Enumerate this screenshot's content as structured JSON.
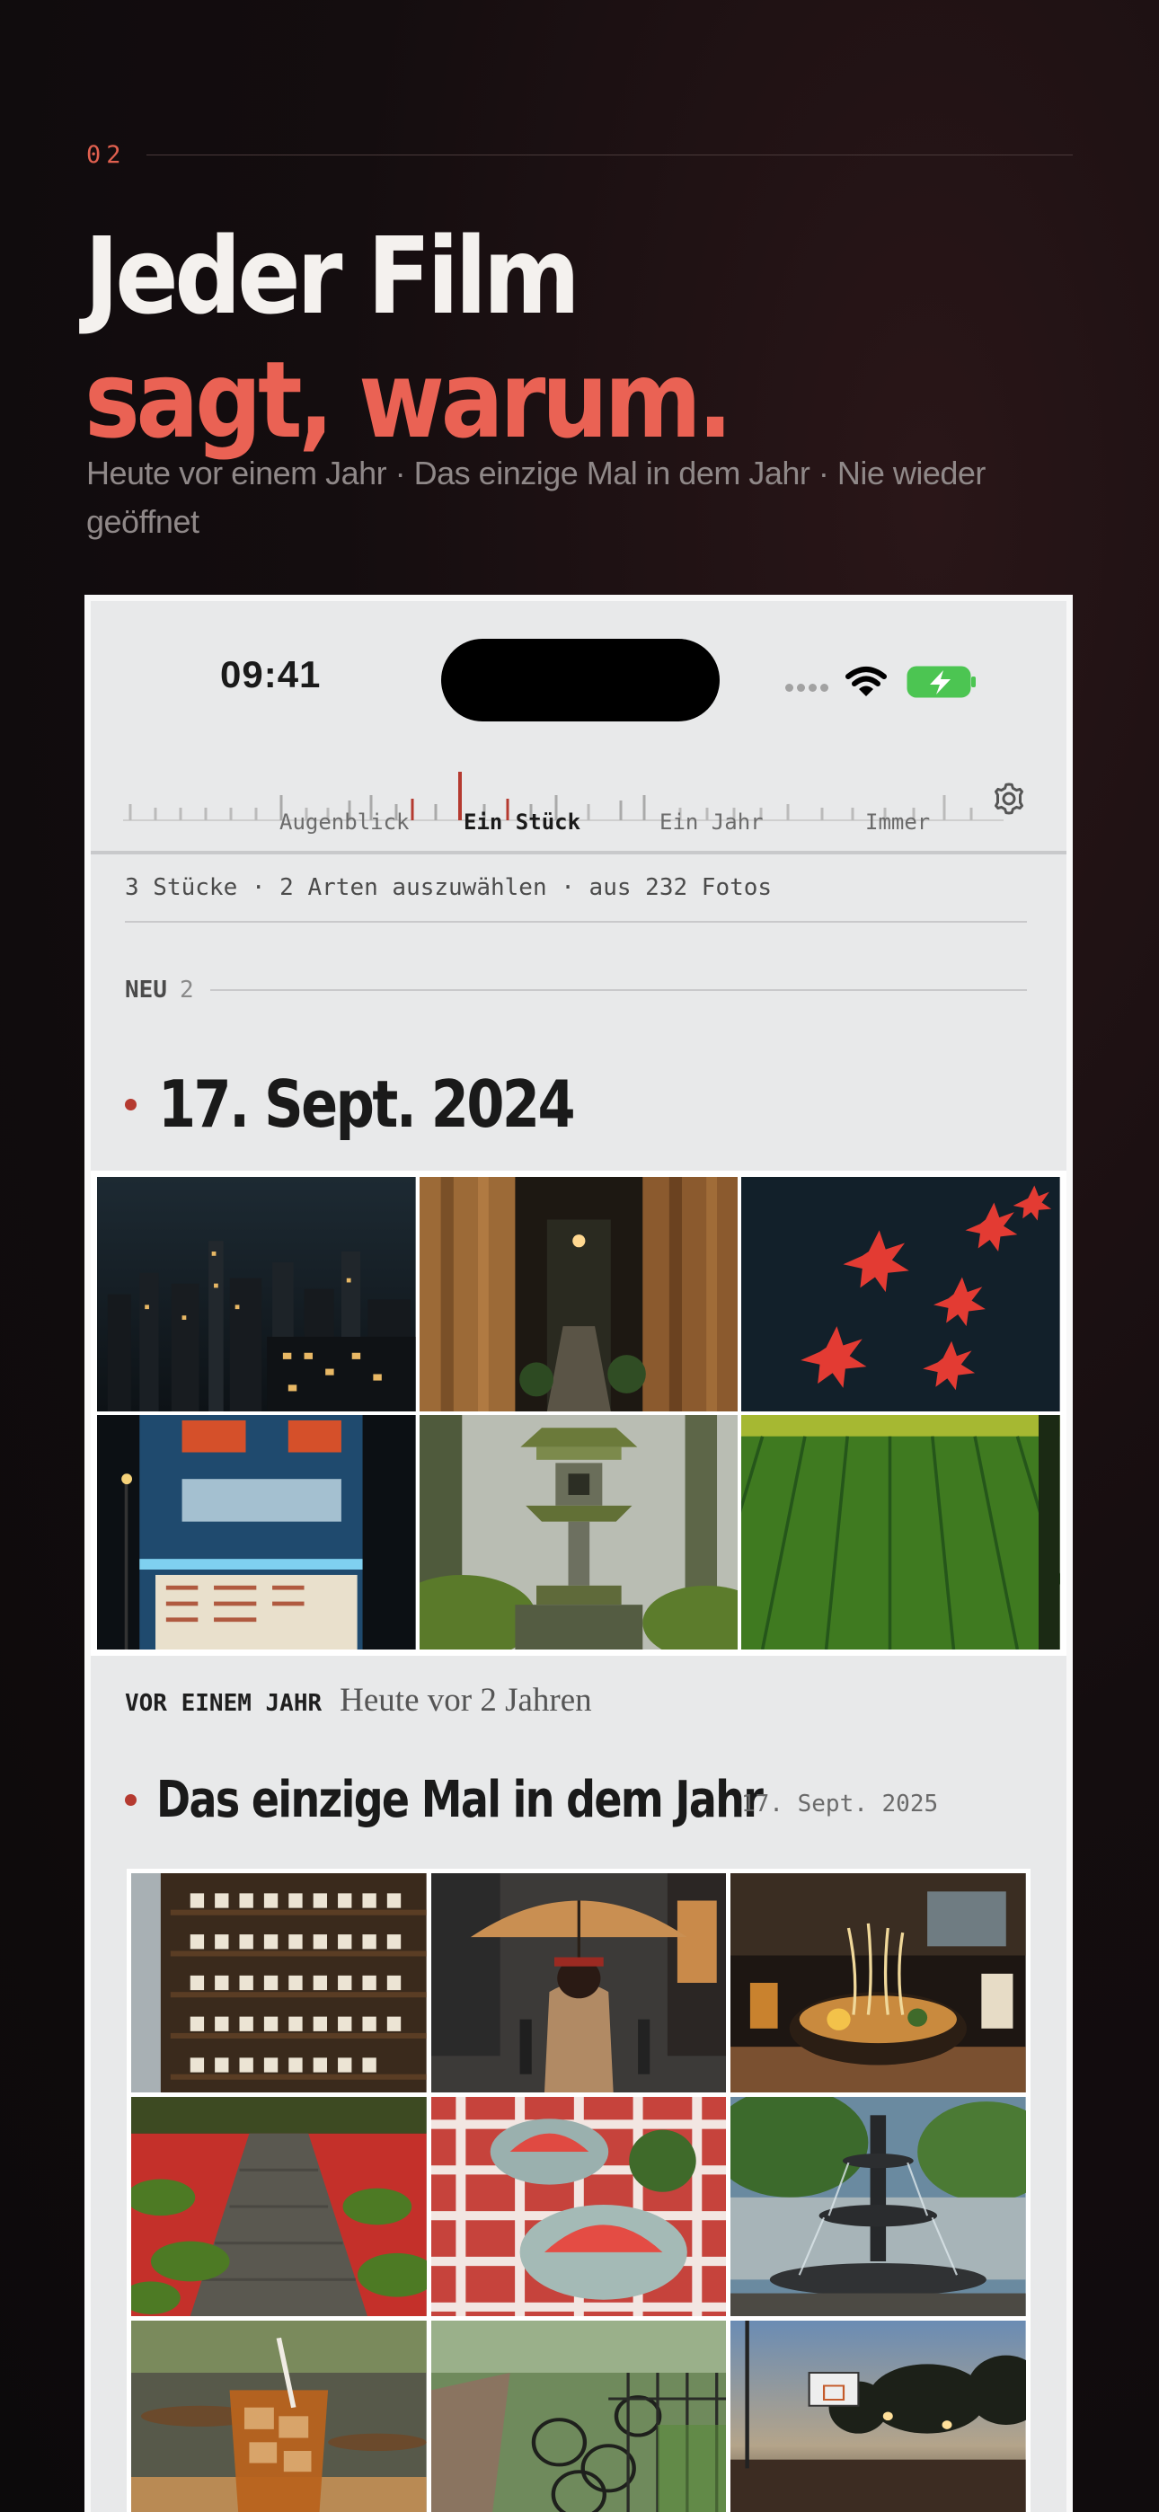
{
  "section": {
    "number": "02",
    "title_line1": "Jeder Film",
    "title_line2": "sagt, warum.",
    "subtitle": "Heute vor einem Jahr · Das einzige Mal in dem Jahr · Nie wieder geöffnet"
  },
  "phone": {
    "status_bar": {
      "time": "09:41"
    },
    "scale": {
      "labels": [
        "Augenblick",
        "Ein Stück",
        "Ein Jahr",
        "Immer"
      ],
      "active_label": "Ein Stück"
    },
    "summary": "3 Stücke · 2 Arten auszuwählen · aus 232 Fotos",
    "group_new": {
      "label": "NEU",
      "count": "2"
    },
    "film1": {
      "title": "17. Sept. 2024",
      "photos": [
        "night-skyline-rain",
        "narrow-alley-curtains",
        "red-maple-leaves-water",
        "blue-convenience-store-night",
        "mossy-stone-lantern",
        "green-rice-field"
      ],
      "caption_tag": "VOR EINEM JAHR",
      "caption_text": "Heute vor 2 Jahren"
    },
    "film2": {
      "title": "Das einzige Mal in dem Jahr",
      "date": "17. Sept. 2025",
      "photos": [
        "cup-shelves-shop",
        "umbrella-street-rain",
        "ramen-bowl",
        "moss-garden-path",
        "watermelon-picnic",
        "park-fountain",
        "iced-tea-cafe",
        "bicycles-railing",
        "basketball-court-dusk"
      ]
    },
    "accent_color": "#b53a30"
  },
  "colors": {
    "accent": "#ea6254",
    "background": "#140d0f",
    "phone_bg": "#e8e9ea"
  }
}
